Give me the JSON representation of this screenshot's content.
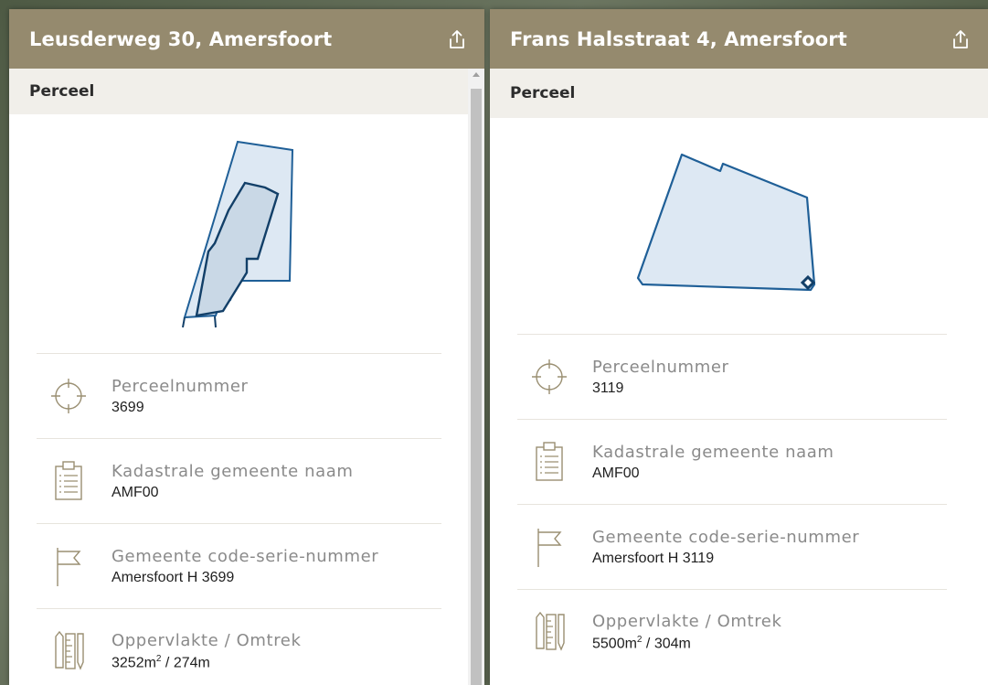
{
  "panels": [
    {
      "title": "Leusderweg 30, Amersfoort",
      "section": "Perceel",
      "rows": [
        {
          "label": "Perceelnummer",
          "value": "3699",
          "icon": "crosshair-icon"
        },
        {
          "label": "Kadastrale gemeente naam",
          "value": "AMF00",
          "icon": "clipboard-icon"
        },
        {
          "label": "Gemeente code-serie-nummer",
          "value": "Amersfoort H 3699",
          "icon": "flag-icon"
        },
        {
          "label": "Oppervlakte / Omtrek",
          "area": "3252m",
          "area_unit_sup": "2",
          "perimeter": " / 274m",
          "icon": "ruler-icon"
        }
      ]
    },
    {
      "title": "Frans Halsstraat 4, Amersfoort",
      "section": "Perceel",
      "rows": [
        {
          "label": "Perceelnummer",
          "value": "3119",
          "icon": "crosshair-icon"
        },
        {
          "label": "Kadastrale gemeente naam",
          "value": "AMF00",
          "icon": "clipboard-icon"
        },
        {
          "label": "Gemeente code-serie-nummer",
          "value": "Amersfoort H 3119",
          "icon": "flag-icon"
        },
        {
          "label": "Oppervlakte / Omtrek",
          "area": "5500m",
          "area_unit_sup": "2",
          "perimeter": " / 304m",
          "icon": "ruler-icon"
        }
      ]
    }
  ],
  "colors": {
    "header": "#958a6e",
    "section_bar": "#f1efea",
    "parcel_fill": "#dde8f3",
    "parcel_stroke": "#1f5f97",
    "building_fill": "#c9d8e6",
    "icon_stroke": "#9a8f72"
  }
}
